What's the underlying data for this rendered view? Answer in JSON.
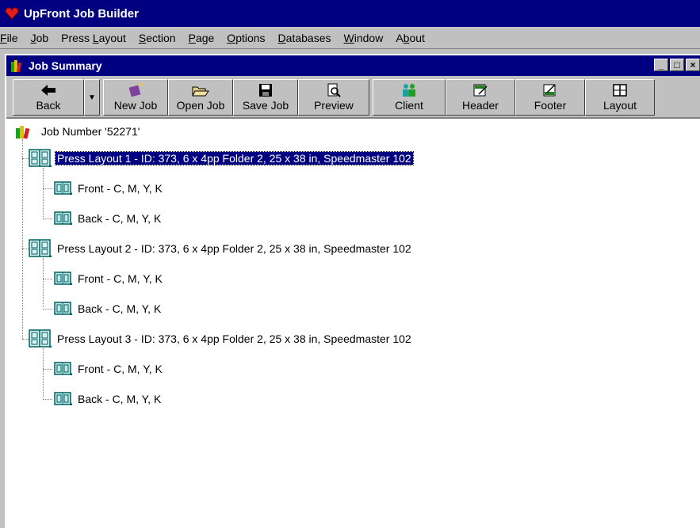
{
  "app": {
    "title": "UpFront Job Builder"
  },
  "menu": [
    {
      "label": "File",
      "u": "F",
      "rest": "ile"
    },
    {
      "label": "Job",
      "u": "J",
      "rest": "ob"
    },
    {
      "label": "Press Layout",
      "pre": "Press ",
      "u": "L",
      "rest": "ayout"
    },
    {
      "label": "Section",
      "u": "S",
      "rest": "ection"
    },
    {
      "label": "Page",
      "u": "P",
      "rest": "age"
    },
    {
      "label": "Options",
      "u": "O",
      "rest": "ptions"
    },
    {
      "label": "Databases",
      "u": "D",
      "rest": "atabases"
    },
    {
      "label": "Window",
      "u": "W",
      "rest": "indow"
    },
    {
      "label": "About",
      "pre": "A",
      "u": "b",
      "rest": "out"
    }
  ],
  "window": {
    "title": "Job Summary"
  },
  "toolbar": {
    "back": "Back",
    "new_job": "New Job",
    "open_job": "Open Job",
    "save_job": "Save Job",
    "preview": "Preview",
    "client": "Client",
    "header": "Header",
    "footer": "Footer",
    "layout": "Layout"
  },
  "tree": {
    "root": "Job Number '52271'",
    "layouts": [
      {
        "label": "Press Layout 1 - ID: 373, 6 x 4pp Folder 2, 25 x 38 in, Speedmaster 102",
        "selected": true,
        "sections": [
          "Front - C, M, Y, K",
          "Back - C, M, Y, K"
        ]
      },
      {
        "label": "Press Layout 2 - ID: 373, 6 x 4pp Folder 2, 25 x 38 in, Speedmaster 102",
        "selected": false,
        "sections": [
          "Front - C, M, Y, K",
          "Back - C, M, Y, K"
        ]
      },
      {
        "label": "Press Layout 3 - ID: 373, 6 x 4pp Folder 2, 25 x 38 in, Speedmaster 102",
        "selected": false,
        "sections": [
          "Front - C, M, Y, K",
          "Back - C, M, Y, K"
        ]
      }
    ]
  },
  "colors": {
    "title_bar": "#000080",
    "face": "#c0c0c0",
    "selection": "#000080"
  }
}
